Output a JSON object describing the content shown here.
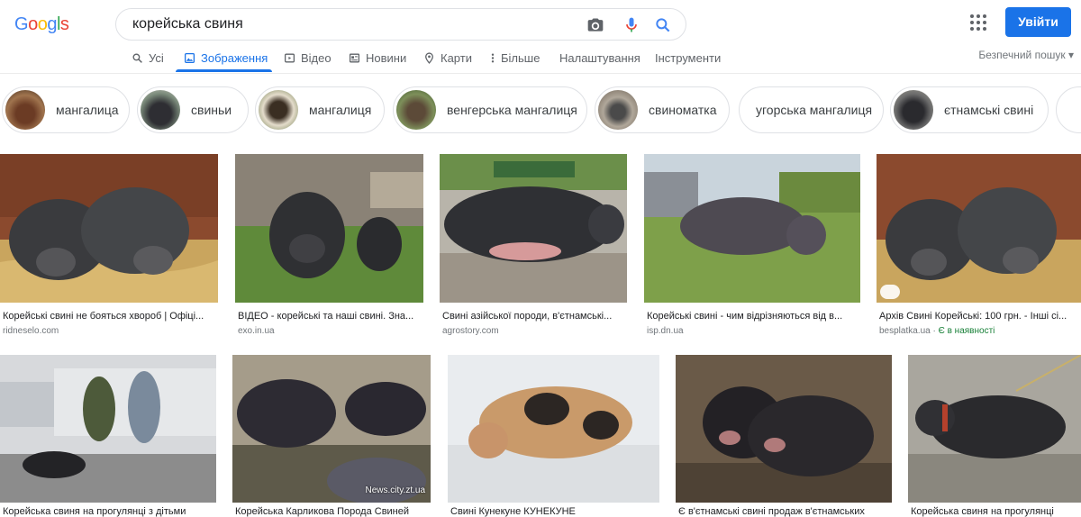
{
  "search": {
    "query": "корейська свиня"
  },
  "header": {
    "signin_label": "Увійти"
  },
  "tabs": [
    {
      "label": "Усі",
      "icon": "search-icon"
    },
    {
      "label": "Зображення",
      "icon": "image-icon"
    },
    {
      "label": "Відео",
      "icon": "video-icon"
    },
    {
      "label": "Новини",
      "icon": "news-icon"
    },
    {
      "label": "Карти",
      "icon": "map-pin-icon"
    },
    {
      "label": "Більше",
      "icon": "more-vert-icon"
    },
    {
      "label": "Налаштування"
    },
    {
      "label": "Інструменти"
    }
  ],
  "safe_search": "Безпечний пошук",
  "chips": [
    "мангалица",
    "свиньи",
    "мангалиця",
    "венгерська мангалиця",
    "свиноматка",
    "угорська мангалиця",
    "єтнамські свині"
  ],
  "results": [
    {
      "caption": "Корейські свині не бояться хвороб | Офіці...",
      "source": "ridneselo.com"
    },
    {
      "caption": "ВІДЕО - корейські та наші свині. Зна...",
      "source": "exo.in.ua"
    },
    {
      "caption": "Свині азійської породи, в'єтнамські...",
      "source": "agrostory.com"
    },
    {
      "caption": "Корейські свині - чим відрізняються від в...",
      "source": "isp.dn.ua"
    },
    {
      "caption": "Архів Свині Корейські: 100 грн. - Інші сі...",
      "source": "besplatka.ua",
      "extra": "Є в наявності"
    },
    {
      "caption": "Корейська свиня на прогулянці з дітьми",
      "source": ""
    },
    {
      "caption": "Корейська Карликова Порода Свиней",
      "source": "",
      "watermark": "News.city.zt.ua"
    },
    {
      "caption": "Свині Кунекуне КУНЕКУНЕ",
      "source": ""
    },
    {
      "caption": "Є в'єтнамські свині продаж в'єтнамських",
      "source": ""
    },
    {
      "caption": "Корейська свиня на прогулянці",
      "source": ""
    }
  ],
  "colors": {
    "accent": "#1a73e8",
    "signin": "#1a73e8",
    "instock": "#188038"
  }
}
